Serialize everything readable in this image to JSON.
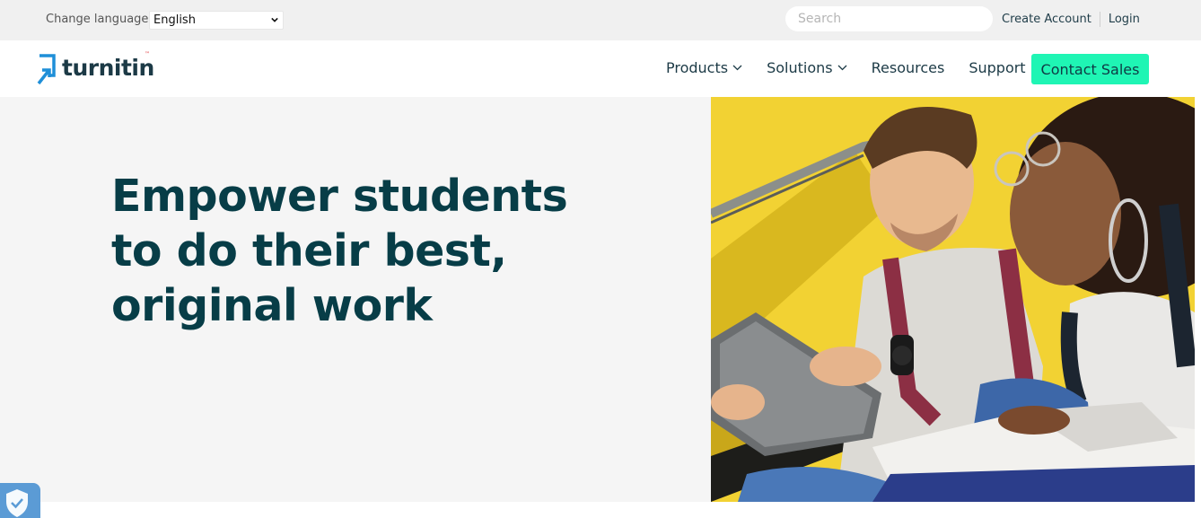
{
  "utility_bar": {
    "change_language_label": "Change language",
    "language_selected": "English",
    "search_placeholder": "Search",
    "create_account": "Create Account",
    "login": "Login"
  },
  "nav": {
    "logo_text": "turnitin",
    "items": [
      {
        "label": "Products",
        "has_dropdown": true
      },
      {
        "label": "Solutions",
        "has_dropdown": true
      },
      {
        "label": "Resources",
        "has_dropdown": false
      },
      {
        "label": "Support",
        "has_dropdown": false
      }
    ],
    "contact_button": "Contact Sales"
  },
  "hero": {
    "title_line1": "Empower students",
    "title_line2": "to do their best,",
    "title_line3": "original work",
    "image_icon": "students-with-tablet-photo"
  },
  "icons": {
    "language_dropdown": "chevron-down-icon",
    "logo": "turnitin-arrow-logo-icon",
    "privacy": "shield-check-icon"
  },
  "colors": {
    "accent": "#1ff5b4",
    "brand_dark": "#073d47",
    "logo_blue": "#1f8fd8",
    "hero_bg": "#f5f5f5",
    "utility_bg": "#f0f0f0"
  }
}
